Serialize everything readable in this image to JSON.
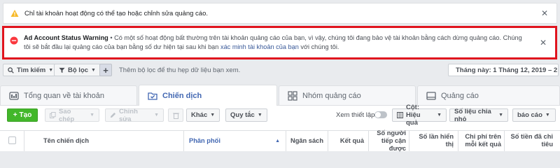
{
  "banner_info": {
    "text": "Chỉ tài khoản hoạt động có thể tạo hoặc chỉnh sửa quảng cáo."
  },
  "banner_warning": {
    "title": "Ad Account Status Warning",
    "body_before_link": " • Có một số hoạt động bất thường trên tài khoản quảng cáo của bạn, vì vậy, chúng tôi đang bảo vệ tài khoản bằng cách dừng quảng cáo. Chúng tôi sẽ bắt đầu lại quảng cáo của bạn bằng số dư hiện tại sau khi bạn ",
    "link": "xác minh tài khoản của bạn",
    "body_after_link": " với chúng tôi."
  },
  "toolbar": {
    "search_label": "Tìm kiếm",
    "filter_label": "Bộ lọc",
    "hint": "Thêm bộ lọc để thu hẹp dữ liệu bạn xem.",
    "date_range": "Tháng này: 1 Tháng 12, 2019 – 2"
  },
  "tabs": [
    {
      "label": "Tổng quan về tài khoản"
    },
    {
      "label": "Chiến dịch"
    },
    {
      "label": "Nhóm quảng cáo"
    },
    {
      "label": "Quảng cáo"
    }
  ],
  "actions": {
    "create": "Tạo",
    "copy": "Sao chép",
    "edit": "Chỉnh sửa",
    "more": "Khác",
    "rules": "Quy tắc",
    "preview": "Xem thiết lập",
    "columns": "Cột: Hiệu quả",
    "breakdown": "Số liệu chia nhỏ",
    "reports": "báo cáo"
  },
  "table": {
    "headers": [
      "Tên chiến dịch",
      "Phân phối",
      "Ngân sách",
      "Kết quả",
      "Số người tiếp cận được",
      "Số lần hiển thị",
      "Chi phí trên mỗi kết quả",
      "Số tiền đã chi tiêu"
    ]
  },
  "colors": {
    "accent": "#4267b2",
    "warning_frame": "#e0141e",
    "create_green": "#42b72a"
  }
}
